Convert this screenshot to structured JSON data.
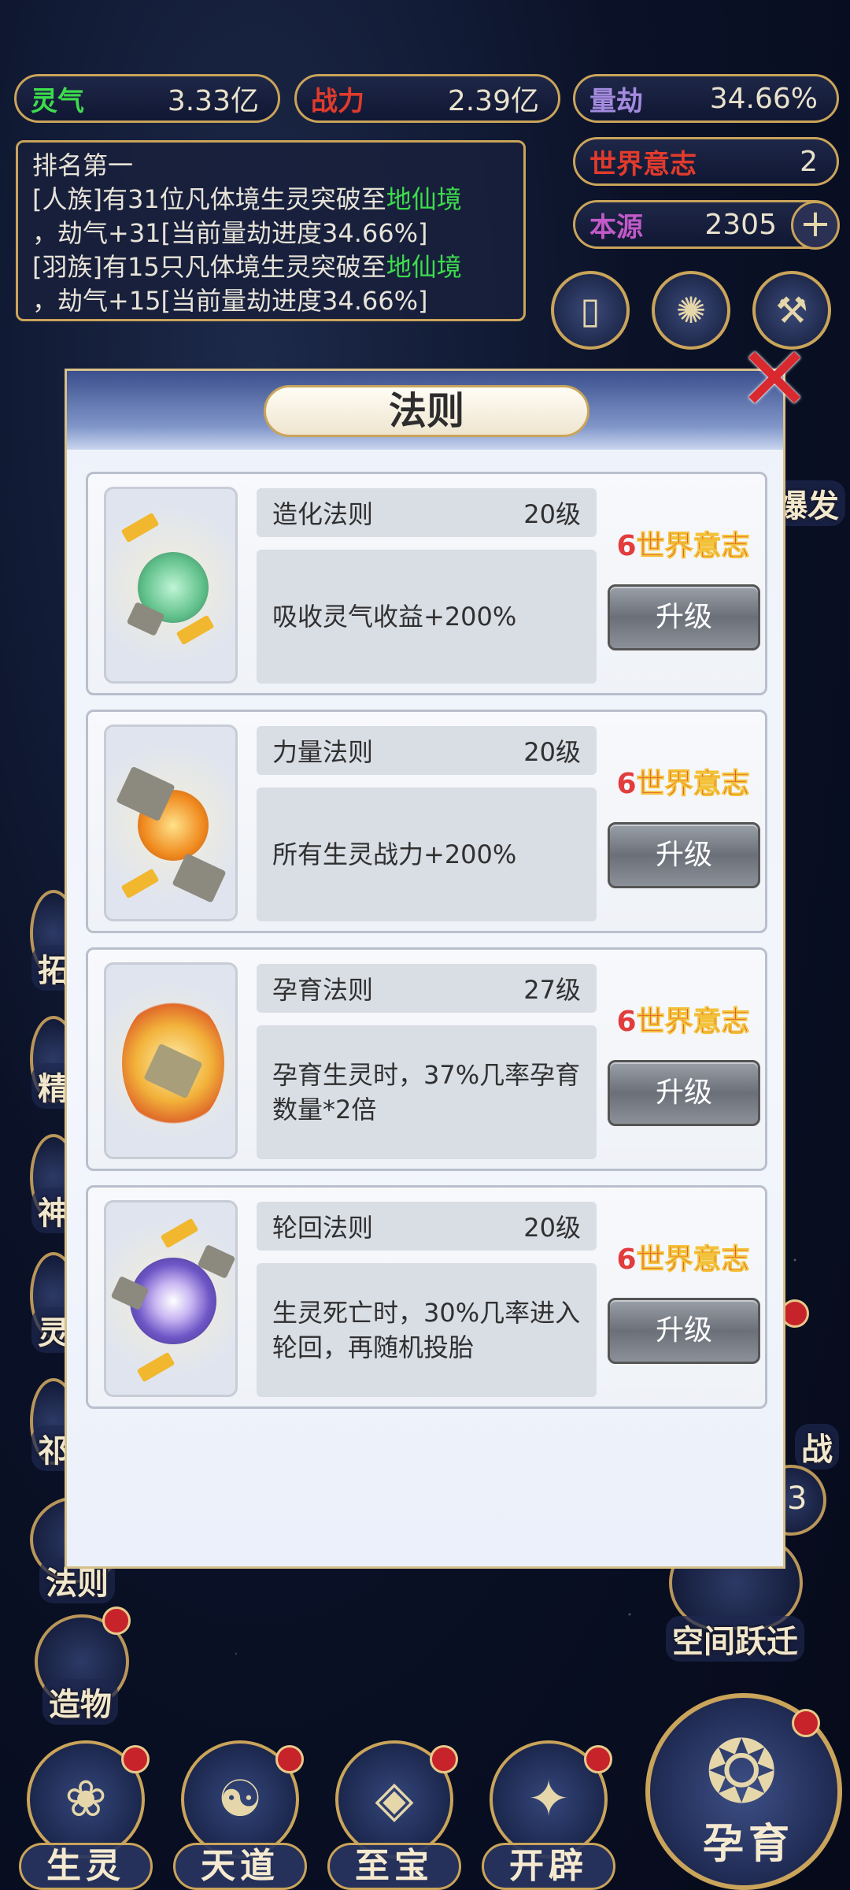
{
  "stats": {
    "lingqi": {
      "label": "灵气",
      "value": "3.33亿",
      "color": "#3ddc4c"
    },
    "zhanli": {
      "label": "战力",
      "value": "2.39亿",
      "color": "#e13b2c"
    },
    "liangjie": {
      "label": "量劫",
      "value": "34.66%",
      "color": "#a58be0"
    },
    "shijie": {
      "label": "世界意志",
      "value": "2",
      "color": "#e13b2c"
    },
    "benyuan": {
      "label": "本源",
      "value": "2305",
      "color": "#c15ac8"
    },
    "plus": "+"
  },
  "news": {
    "title": "排名第一",
    "line1_a": "[人族]有31位凡体境生灵突破至",
    "line1_green": "地仙境",
    "line1_b": "，劫气+31[当前量劫进度34.66%]",
    "line2_a": "[羽族]有15只凡体境生灵突破至",
    "line2_green": "地仙境",
    "line2_b": "，劫气+15[当前量劫进度34.66%]"
  },
  "side": {
    "right_frag1": "爆发",
    "right_frag2": "战",
    "right_num": "3",
    "kongjian": "空间跃迁",
    "left_frag1": "拓",
    "left_frag2": "精",
    "left_frag3": "神",
    "left_frag4": "灵",
    "left_frag5": "祁",
    "fa_ze": "法则",
    "zao_wu": "造物"
  },
  "nav": [
    {
      "label": "生灵"
    },
    {
      "label": "天道"
    },
    {
      "label": "至宝"
    },
    {
      "label": "开辟"
    }
  ],
  "big_nav": {
    "label": "孕育"
  },
  "dialog": {
    "title": "法则",
    "close": "✕",
    "cards": [
      {
        "name": "造化法则",
        "level": "20级",
        "desc": "吸收灵气收益+200%",
        "cost_num": "6",
        "cost_text": "世界意志",
        "btn": "升级"
      },
      {
        "name": "力量法则",
        "level": "20级",
        "desc": "所有生灵战力+200%",
        "cost_num": "6",
        "cost_text": "世界意志",
        "btn": "升级"
      },
      {
        "name": "孕育法则",
        "level": "27级",
        "desc": "孕育生灵时，37%几率孕育数量*2倍",
        "cost_num": "6",
        "cost_text": "世界意志",
        "btn": "升级"
      },
      {
        "name": "轮回法则",
        "level": "20级",
        "desc": "生灵死亡时，30%几率进入轮回，再随机投胎",
        "cost_num": "6",
        "cost_text": "世界意志",
        "btn": "升级"
      }
    ]
  },
  "icons": {
    "top1": "scroll-icon",
    "top2": "vortex-icon",
    "top3": "hammer-icon"
  }
}
